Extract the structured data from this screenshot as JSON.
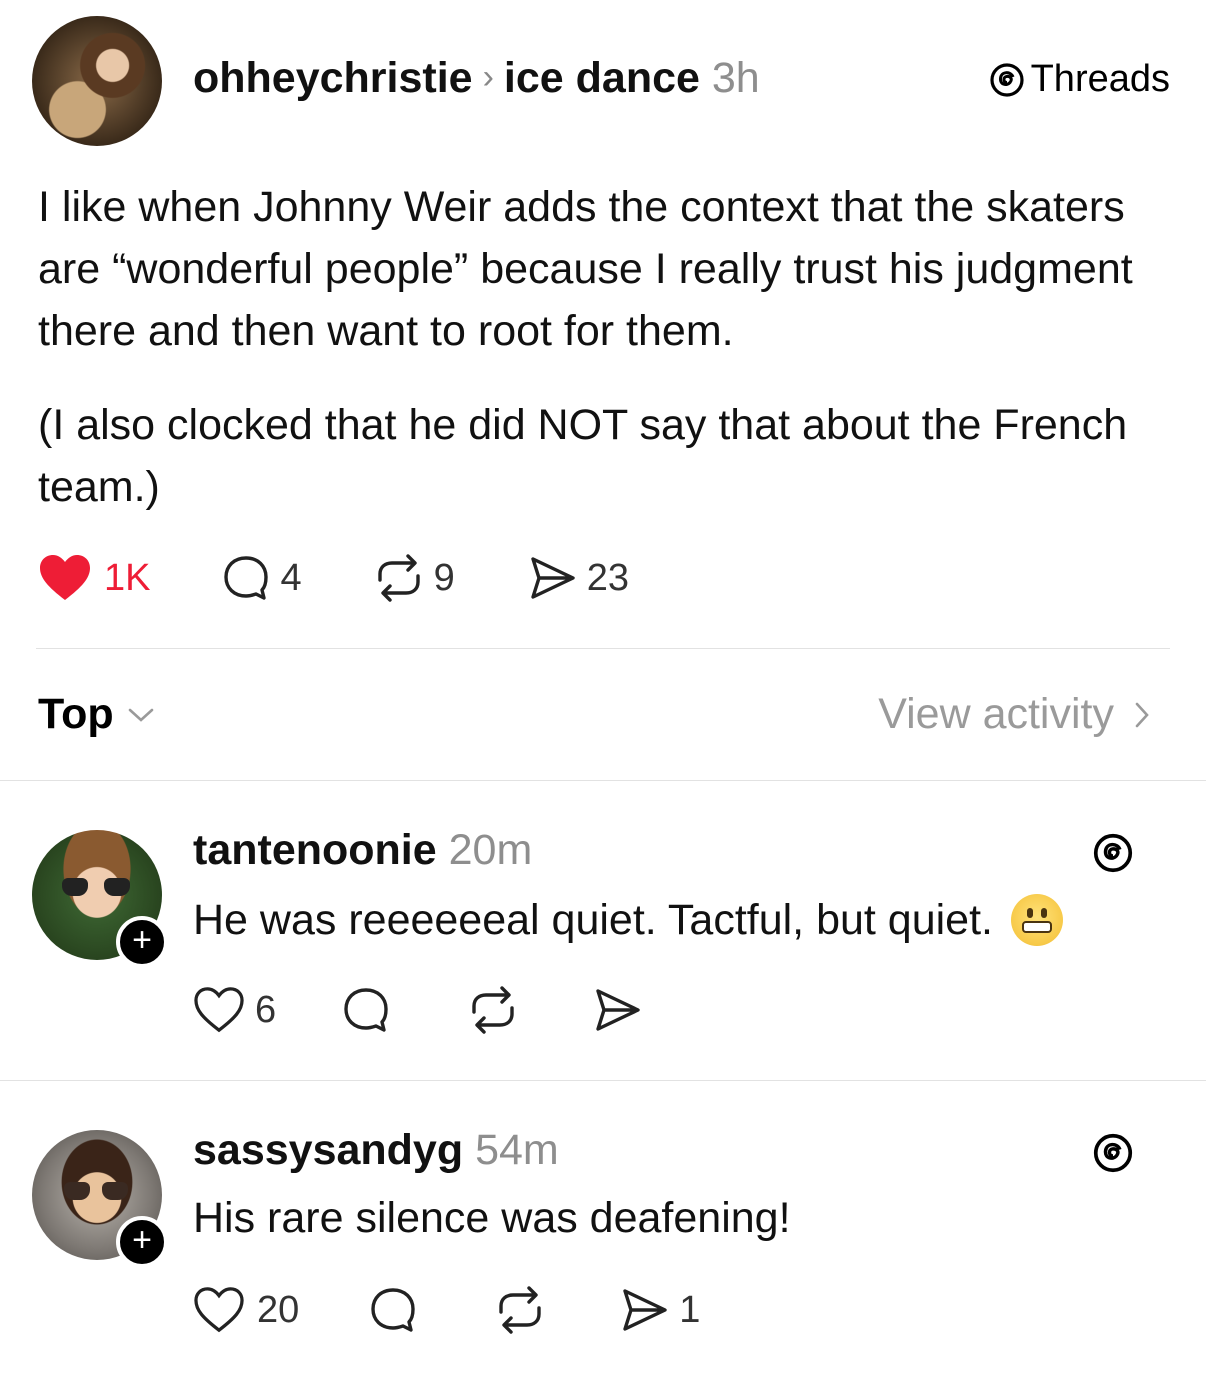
{
  "post": {
    "username": "ohheychristie",
    "separator": "›",
    "topic": "ice dance",
    "time": "3h",
    "source_label": "Threads",
    "paragraphs": [
      "I like when Johnny Weir adds the context that the skaters are “wonderful people” because I really trust his judgment there and then want to root for them.",
      "(I also clocked that he did NOT say that about the French team.)"
    ],
    "likes": "1K",
    "comments": "4",
    "reposts": "9",
    "shares": "23",
    "liked_color": "#ee1d36"
  },
  "sort": {
    "label": "Top",
    "view_activity": "View activity"
  },
  "replies": [
    {
      "username": "tantenoonie",
      "time": "20m",
      "text": "He was reeeeeeal quiet. Tactful, but quiet.",
      "emoji": "grimacing-face",
      "likes": "6",
      "comments": "",
      "reposts": "",
      "shares": ""
    },
    {
      "username": "sassysandyg",
      "time": "54m",
      "text": "His rare silence was deafening!",
      "likes": "20",
      "comments": "",
      "reposts": "",
      "shares": "1"
    }
  ],
  "icons": {
    "like": "heart-icon",
    "comment": "comment-bubble-icon",
    "repost": "repost-icon",
    "share": "send-icon",
    "threads": "threads-logo-icon",
    "sort": "chevron-down-icon",
    "activity": "chevron-right-icon",
    "follow": "plus-icon"
  }
}
